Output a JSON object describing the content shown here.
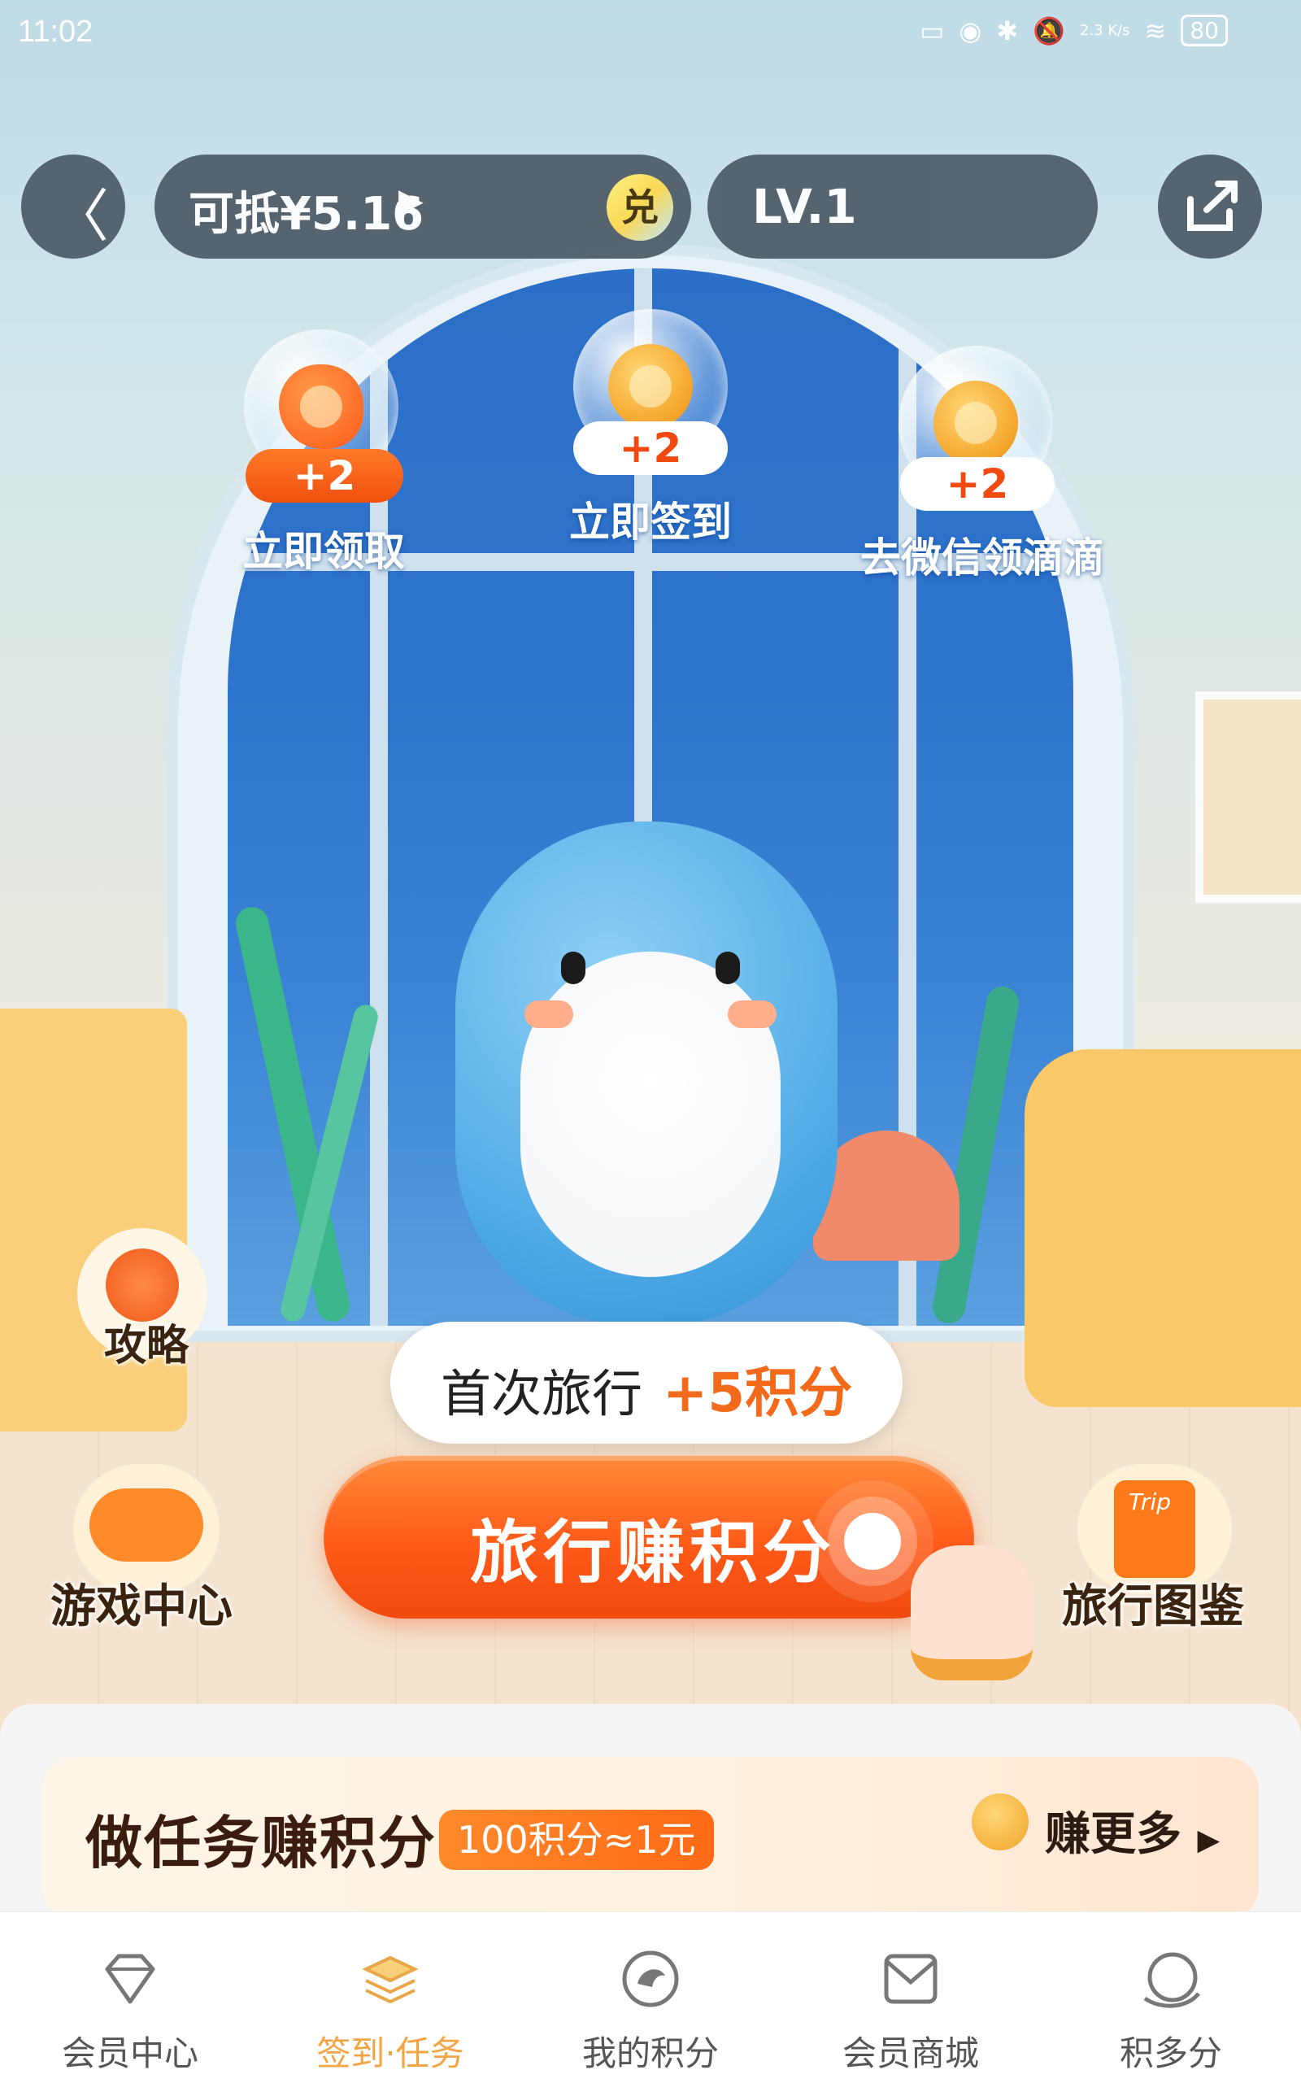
{
  "status_bar": {
    "time": "11:02",
    "net_speed": "2.3 K/s",
    "battery": "80"
  },
  "top_bar": {
    "back_icon": "chevron-left-icon",
    "deduct_text": "可抵¥5.16",
    "redeem_label": "兑",
    "level": "LV.1",
    "share_icon": "share-icon"
  },
  "bubbles": [
    {
      "reward": "+2",
      "label": "立即领取",
      "icon": "goldfish-icon"
    },
    {
      "reward": "+2",
      "label": "立即签到",
      "icon": "dolphin-coin-icon"
    },
    {
      "reward": "+2",
      "label": "去微信领滴滴",
      "icon": "dolphin-coin-icon"
    }
  ],
  "side": {
    "strategy": "攻略",
    "game_center": "游戏中心",
    "travel_guide": "旅行图鉴",
    "trip_tag": "Trip"
  },
  "tooltip": {
    "text": "首次旅行",
    "reward": "+5积分"
  },
  "main_button": "旅行赚积分",
  "task_card": {
    "title": "做任务赚积分",
    "badge": "100积分≈1元",
    "earn_more": "赚更多"
  },
  "tabs": [
    {
      "label": "会员中心",
      "icon": "diamond-icon",
      "active": false
    },
    {
      "label": "签到·任务",
      "icon": "stack-icon",
      "active": true
    },
    {
      "label": "我的积分",
      "icon": "points-coin-icon",
      "active": false
    },
    {
      "label": "会员商城",
      "icon": "mall-bag-icon",
      "active": false
    },
    {
      "label": "积多分",
      "icon": "more-points-icon",
      "active": false
    }
  ],
  "colors": {
    "accent_orange": "#ff5a18",
    "tab_active": "#f3a545",
    "pill_dark": "#4d5a66"
  }
}
